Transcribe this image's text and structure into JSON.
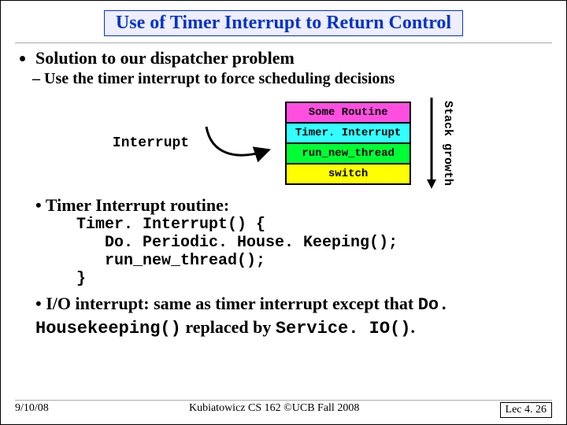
{
  "title": "Use of Timer Interrupt to Return Control",
  "bullets": {
    "solution": "Solution to our dispatcher problem",
    "sub_use": "Use the timer interrupt to force scheduling decisions"
  },
  "diagram": {
    "interrupt_label": "Interrupt",
    "stack": [
      "Some Routine",
      "Timer. Interrupt",
      "run_new_thread",
      "switch"
    ],
    "growth_label": "Stack growth"
  },
  "routine_intro": "Timer Interrupt routine:",
  "code_lines": [
    "Timer. Interrupt() {",
    "   Do. Periodic. House. Keeping();",
    "   run_new_thread();",
    "}"
  ],
  "io_line": {
    "pre": "I/O interrupt: same as timer interrupt except that ",
    "code1": "Do. Housekeeping()",
    "mid": " replaced by ",
    "code2": "Service. IO()",
    "post": "."
  },
  "footer": {
    "date": "9/10/08",
    "center": "Kubiatowicz CS 162 ©UCB Fall 2008",
    "lec": "Lec 4. 26"
  }
}
